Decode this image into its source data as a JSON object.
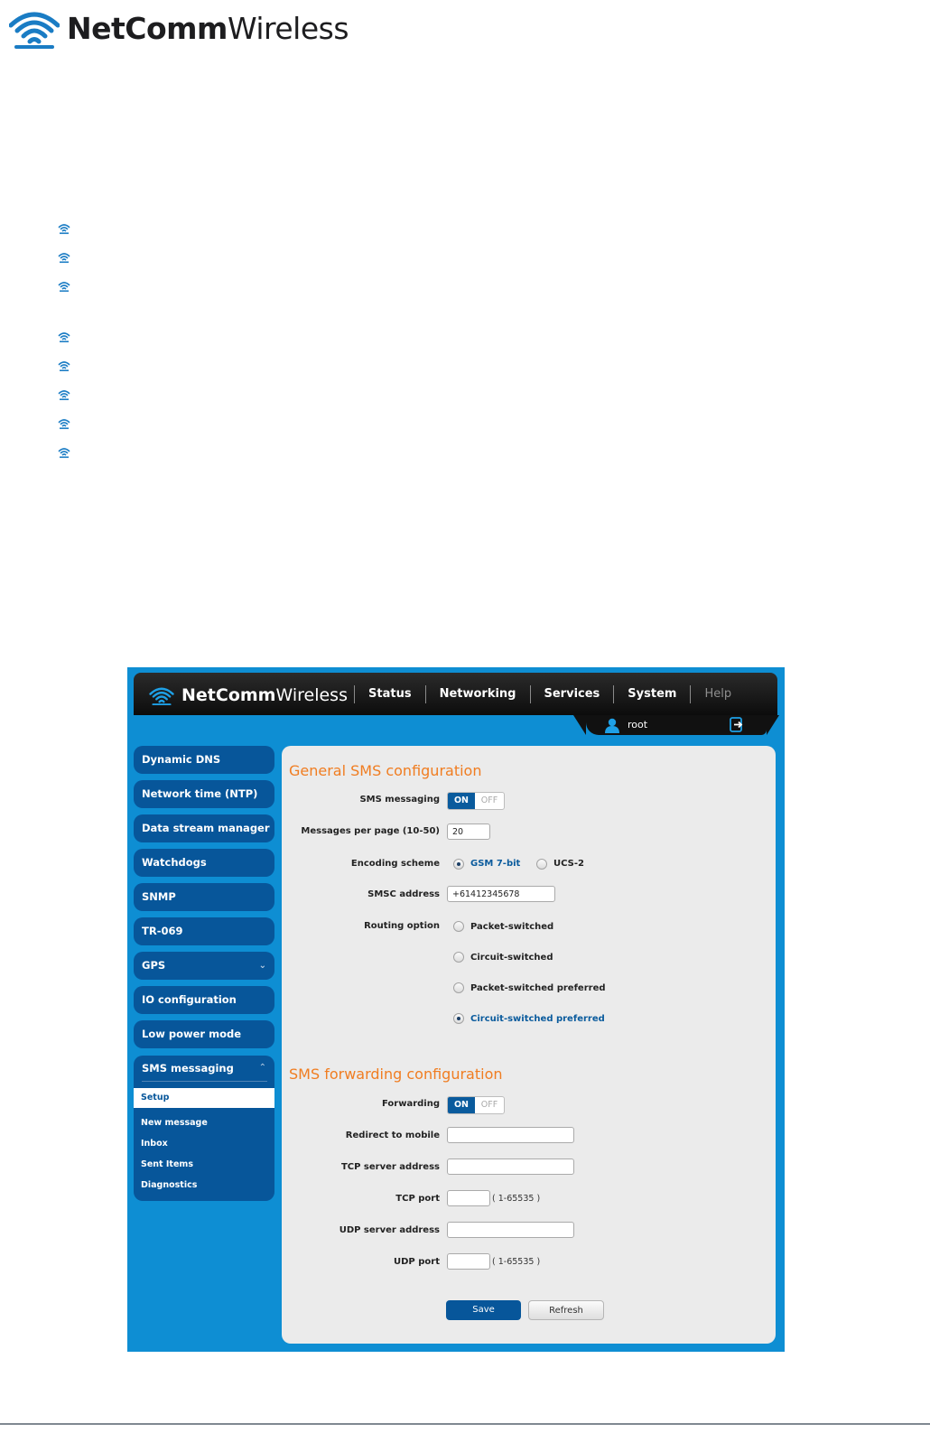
{
  "document": {
    "logo_bold": "NetComm",
    "logo_light": "Wireless",
    "bullet_count": 8
  },
  "app": {
    "brand_bold": "NetComm",
    "brand_light": "Wireless",
    "nav": [
      "Status",
      "Networking",
      "Services",
      "System",
      "Help"
    ],
    "user": "root"
  },
  "sidebar": {
    "items": [
      "Dynamic DNS",
      "Network time (NTP)",
      "Data stream manager",
      "Watchdogs",
      "SNMP",
      "TR-069",
      "GPS",
      "IO configuration",
      "Low power mode"
    ],
    "expanded_group": "SMS messaging",
    "sub_items": [
      "Setup",
      "New message",
      "Inbox",
      "Sent Items",
      "Diagnostics"
    ],
    "active_sub_item": "Setup"
  },
  "general": {
    "title": "General SMS configuration",
    "sms_messaging_label": "SMS messaging",
    "toggle_on": "ON",
    "toggle_off": "OFF",
    "messages_per_page_label": "Messages per page (10-50)",
    "messages_per_page_value": "20",
    "encoding_label": "Encoding scheme",
    "encoding_options": [
      "GSM 7-bit",
      "UCS-2"
    ],
    "encoding_selected": "GSM 7-bit",
    "smsc_label": "SMSC address",
    "smsc_value": "+61412345678",
    "routing_label": "Routing option",
    "routing_options": [
      "Packet-switched",
      "Circuit-switched",
      "Packet-switched preferred",
      "Circuit-switched preferred"
    ],
    "routing_selected": "Circuit-switched preferred"
  },
  "forwarding": {
    "title": "SMS forwarding configuration",
    "forwarding_label": "Forwarding",
    "toggle_on": "ON",
    "toggle_off": "OFF",
    "redirect_label": "Redirect to mobile",
    "redirect_value": "",
    "tcp_server_label": "TCP server address",
    "tcp_server_value": "",
    "tcp_port_label": "TCP port",
    "tcp_port_value": "",
    "tcp_port_hint": "( 1-65535 )",
    "udp_server_label": "UDP server address",
    "udp_server_value": "",
    "udp_port_label": "UDP port",
    "udp_port_value": "",
    "udp_port_hint": "( 1-65535 )"
  },
  "buttons": {
    "save": "Save",
    "refresh": "Refresh"
  },
  "colors": {
    "brand_blue": "#0e8ed3",
    "nav_dark": "#111111",
    "sidebar_blue": "#07569a",
    "section_orange": "#f07d21"
  }
}
